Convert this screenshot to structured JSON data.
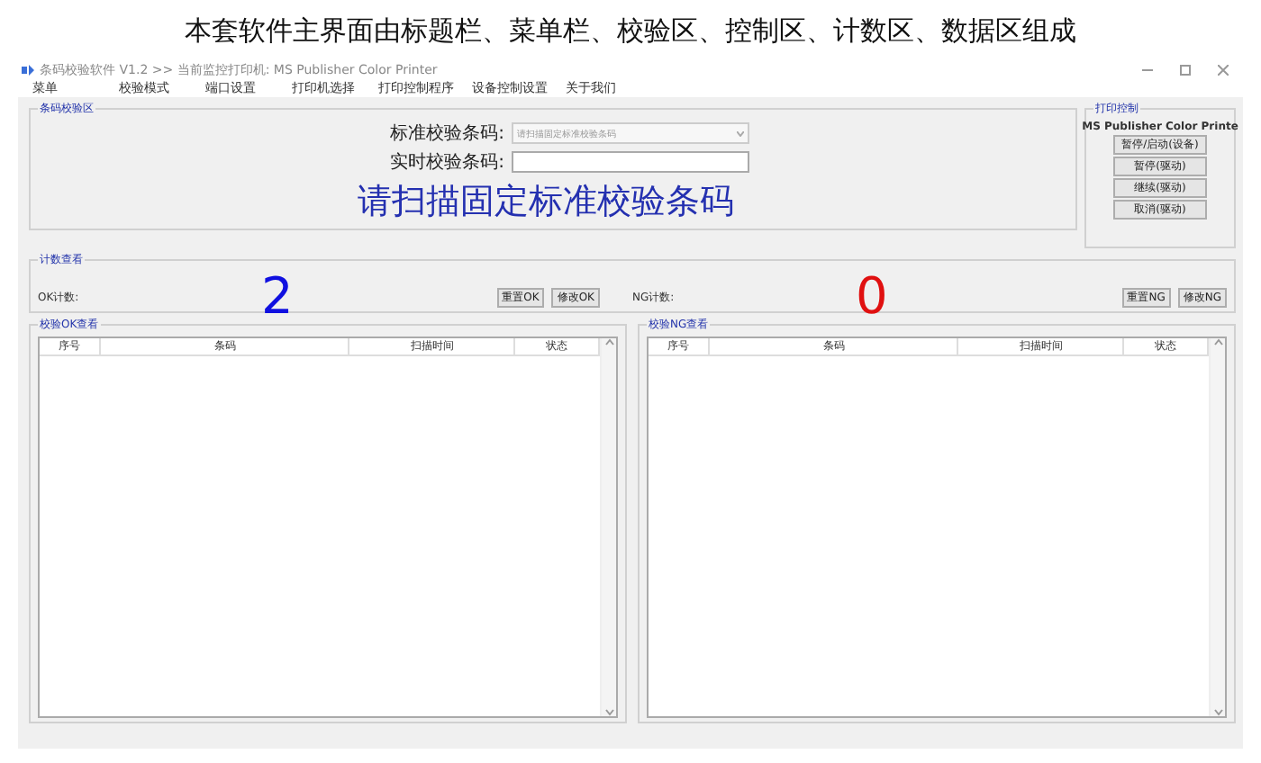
{
  "caption": "本套软件主界面由标题栏、菜单栏、校验区、控制区、计数区、数据区组成",
  "window": {
    "title": "条码校验软件 V1.2   >> 当前监控打印机: MS Publisher Color Printer"
  },
  "menu": [
    "菜单",
    "校验模式",
    "端口设置",
    "打印机选择",
    "打印控制程序",
    "设备控制设置",
    "关于我们"
  ],
  "verify": {
    "title": "条码校验区",
    "standard_label": "标准校验条码:",
    "standard_placeholder": "请扫描固定标准校验条码",
    "realtime_label": "实时校验条码:",
    "prompt": "请扫描固定标准校验条码"
  },
  "print_control": {
    "title": "打印控制",
    "printer": "MS Publisher Color Printe",
    "buttons": [
      "暂停/启动(设备)",
      "暂停(驱动)",
      "继续(驱动)",
      "取消(驱动)"
    ]
  },
  "counts": {
    "title": "计数查看",
    "ok_label": "OK计数:",
    "ok_value": "2",
    "ok_buttons": [
      "重置OK",
      "修改OK"
    ],
    "ng_label": "NG计数:",
    "ng_value": "0",
    "ng_buttons": [
      "重置NG",
      "修改NG"
    ]
  },
  "tables": [
    {
      "title": "校验OK查看",
      "columns": [
        "序号",
        "条码",
        "扫描时间",
        "状态"
      ]
    },
    {
      "title": "校验NG查看",
      "columns": [
        "序号",
        "条码",
        "扫描时间",
        "状态"
      ]
    }
  ]
}
